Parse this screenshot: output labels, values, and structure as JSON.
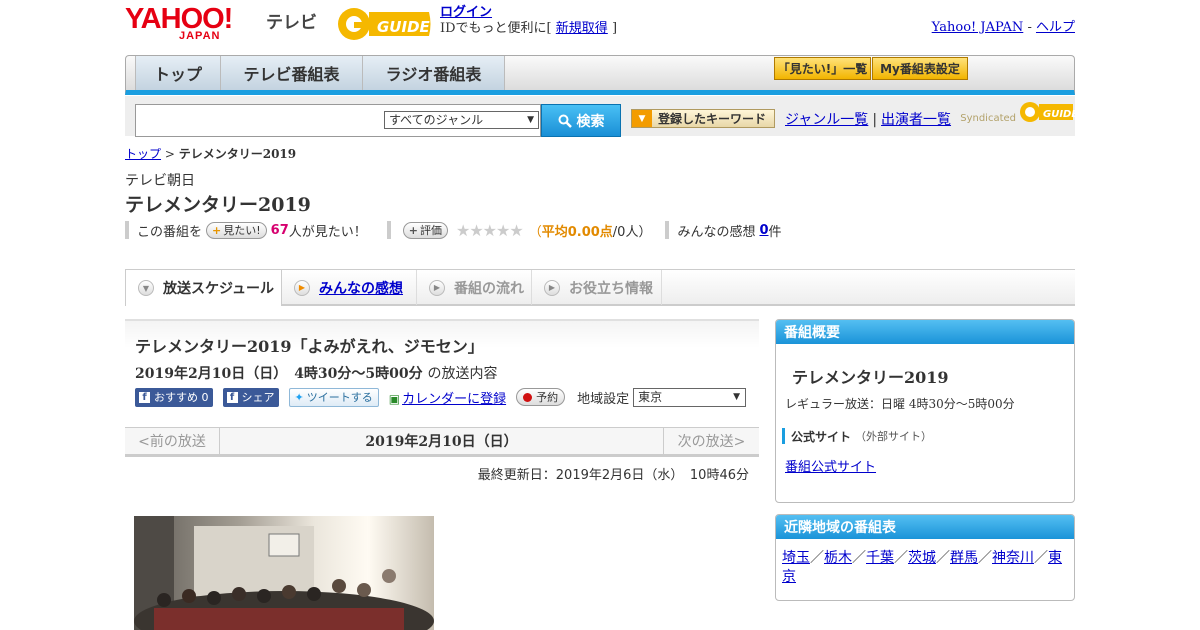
{
  "header": {
    "yahoo_logo": "YAHOO!",
    "yahoo_sub": "JAPAN",
    "service": "テレビ",
    "login_label": "ログイン",
    "login_text_prefix": "IDでもっと便利に[",
    "signup_label": "新規取得",
    "login_text_suffix": "]",
    "yahoo_japan_link": "Yahoo! JAPAN",
    "separator": "-",
    "help_link": "ヘルプ"
  },
  "nav": {
    "tabs": [
      "トップ",
      "テレビ番組表",
      "ラジオ番組表"
    ],
    "want_list": "「見たい!」一覧",
    "my_schedule": "My番組表設定"
  },
  "search": {
    "placeholder": "",
    "genre_selected": "すべてのジャンル",
    "button": "検索",
    "keyword_button": "登録したキーワード",
    "genre_link": "ジャンル一覧",
    "link_sep": "|",
    "performer_link": "出演者一覧",
    "syndicated": "Syndicated"
  },
  "breadcrumb": {
    "top": "トップ",
    "sep": ">",
    "current": "テレメンタリー2019"
  },
  "program": {
    "station": "テレビ朝日",
    "title": "テレメンタリー2019",
    "want_prefix": "この番組を",
    "want_button": "見たい!",
    "want_count": "67",
    "want_suffix": "人が見たい！",
    "rate_button": "評価",
    "stars": "★★★★★",
    "avg_open": "（",
    "avg_label": "平均0.00点",
    "avg_people": "/0人）",
    "review_prefix": "みんなの感想",
    "review_count": "0",
    "review_suffix": "件"
  },
  "tabs": [
    {
      "label": "放送スケジュール"
    },
    {
      "label": "みんなの感想"
    },
    {
      "label": "番組の流れ"
    },
    {
      "label": "お役立ち情報"
    }
  ],
  "episode": {
    "title": "テレメンタリー2019「よみがえれ、ジモセン」",
    "datetime": "2019年2月10日（日）　4時30分～5時00分",
    "datetime_suffix": "の放送内容",
    "fb_recommend": "おすすめ 0",
    "fb_share": "シェア",
    "tweet": "ツイートする",
    "calendar": "カレンダーに登録",
    "reserve": "予約",
    "region_label": "地域設定",
    "region_value": "東京",
    "prev": "<前の放送",
    "current_date": "2019年2月10日（日）",
    "next": "次の放送>",
    "updated": "最終更新日：2019年2月6日（水）　10時46分"
  },
  "overview": {
    "heading": "番組概要",
    "title": "テレメンタリー2019",
    "regular": "レギュラー放送：日曜 4時30分～5時00分",
    "official_label": "公式サイト",
    "official_note": "（外部サイト）",
    "official_link": "番組公式サイト"
  },
  "nearby": {
    "heading": "近隣地域の番組表",
    "regions": [
      "埼玉",
      "栃木",
      "千葉",
      "茨城",
      "群馬",
      "神奈川",
      "東京"
    ],
    "sep": "／"
  },
  "colors": {
    "accent": "#1a9ee0",
    "yahoo_red": "#e60012",
    "link": "#0000cc",
    "gguide_yellow": "#f5b800"
  }
}
